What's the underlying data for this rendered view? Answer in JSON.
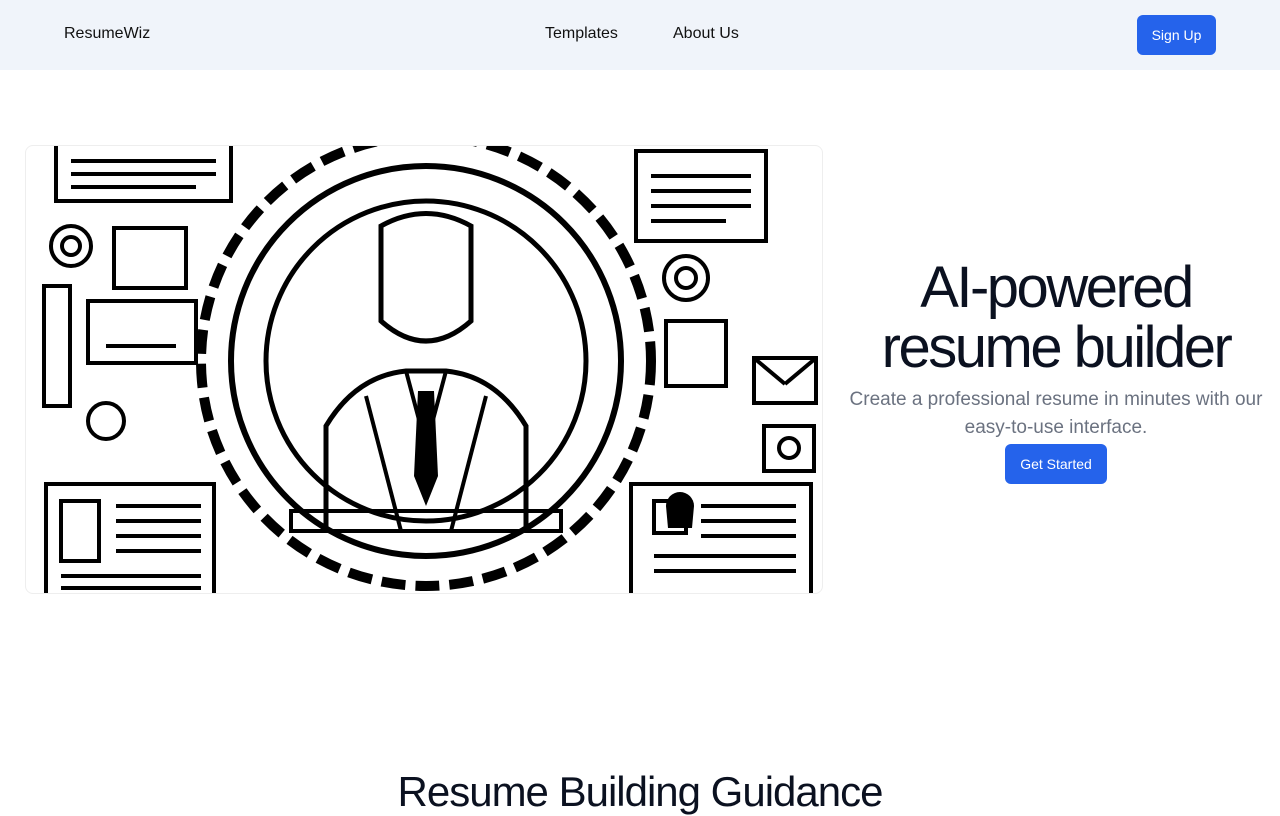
{
  "nav": {
    "brand": "ResumeWiz",
    "links": [
      "Templates",
      "About Us"
    ],
    "signup_label": "Sign Up"
  },
  "hero": {
    "title_line1": "AI-powered",
    "title_line2": "resume builder",
    "subtitle": "Create a professional resume in minutes with our easy-to-use interface.",
    "cta_label": "Get Started"
  },
  "section": {
    "title": "Resume Building Guidance"
  },
  "colors": {
    "accent": "#2563eb",
    "nav_bg": "#f0f4fa",
    "heading": "#0b1120",
    "muted": "#6b7280"
  }
}
